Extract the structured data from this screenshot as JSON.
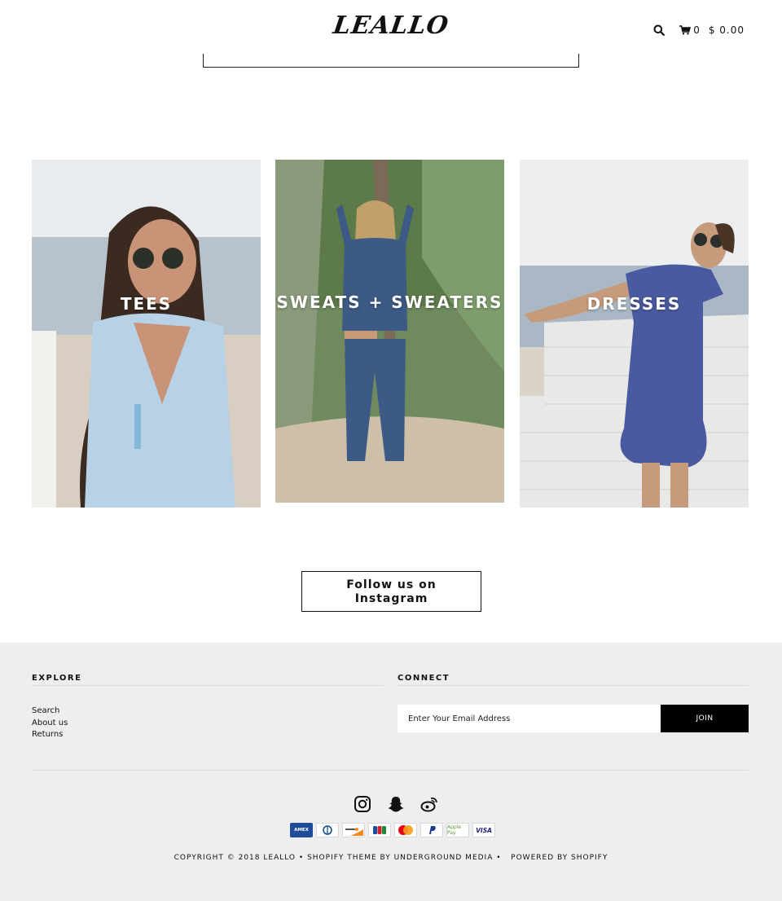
{
  "header": {
    "logo": "LEALLO",
    "cart_count": "0",
    "cart_total": "$ 0.00",
    "icons": [
      "search-icon",
      "cart-icon"
    ]
  },
  "collections": [
    {
      "label": "TEES"
    },
    {
      "label": "SWEATS + SWEATERS"
    },
    {
      "label": "DRESSES"
    }
  ],
  "instagram_button": {
    "line1": "Follow us on",
    "line2": "Instagram"
  },
  "footer": {
    "explore": {
      "heading": "EXPLORE",
      "links": [
        "Search",
        "About us",
        "Returns"
      ]
    },
    "connect": {
      "heading": "CONNECT",
      "email_placeholder": "Enter Your Email Address",
      "join_label": "JOIN"
    },
    "social_icons": [
      "instagram-icon",
      "snapchat-icon",
      "weibo-icon"
    ],
    "payments": [
      {
        "name": "AMEX",
        "icon": "amex-icon"
      },
      {
        "name": "Diners",
        "icon": "diners-icon"
      },
      {
        "name": "Discover",
        "icon": "discover-icon"
      },
      {
        "name": "JCB",
        "icon": "jcb-icon"
      },
      {
        "name": "Mastercard",
        "icon": "mastercard-icon"
      },
      {
        "name": "PayPal",
        "icon": "paypal-icon"
      },
      {
        "name": "Apple Pay",
        "icon": "applepay-icon"
      },
      {
        "name": "VISA",
        "icon": "visa-icon"
      }
    ],
    "copyright": {
      "prefix": "COPYRIGHT © 2018 LEALLO",
      "theme_link": "SHOPIFY THEME BY UNDERGROUND MEDIA",
      "powered_link": "POWERED BY SHOPIFY"
    }
  },
  "colors": {
    "footer_bg": "#eeeeee",
    "button_black": "#000000",
    "text": "#111111"
  }
}
